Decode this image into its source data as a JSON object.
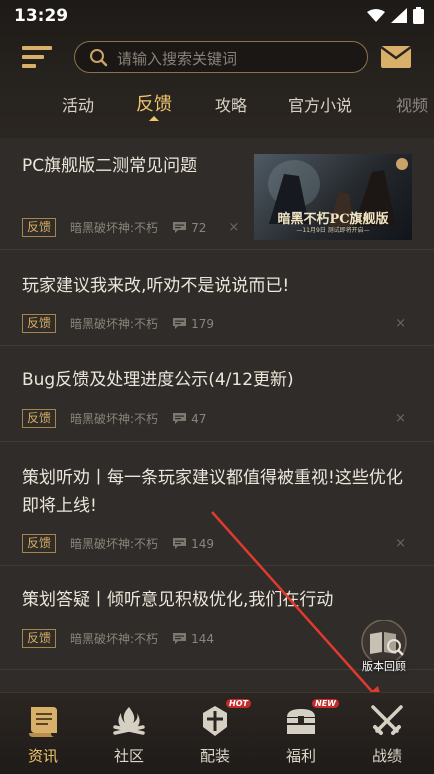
{
  "status": {
    "time": "13:29"
  },
  "search": {
    "placeholder": "请输入搜索关键词"
  },
  "tabs": [
    {
      "label": "活动"
    },
    {
      "label": "反馈"
    },
    {
      "label": "攻略"
    },
    {
      "label": "官方小说"
    },
    {
      "label": "视频"
    }
  ],
  "active_tab": "反馈",
  "articles": [
    {
      "title": "PC旗舰版二测常见问题",
      "tag": "反馈",
      "author": "暗黑破坏神:不朽",
      "comments": "72",
      "thumbnail": {
        "title": "暗黑不朽PC旗舰版",
        "subtitle": "—11月9日 测试即将开启—"
      }
    },
    {
      "title": "玩家建议我来改,听劝不是说说而已!",
      "tag": "反馈",
      "author": "暗黑破坏神:不朽",
      "comments": "179"
    },
    {
      "title": "Bug反馈及处理进度公示(4/12更新)",
      "tag": "反馈",
      "author": "暗黑破坏神:不朽",
      "comments": "47"
    },
    {
      "title_line1": "策划听劝丨每一条玩家建议都值得被重视!这些优化",
      "title_line2": "即将上线!",
      "tag": "反馈",
      "author": "暗黑破坏神:不朽",
      "comments": "149"
    },
    {
      "title": "策划答疑丨倾听意见积极优化,我们在行动",
      "tag": "反馈",
      "author": "暗黑破坏神:不朽",
      "comments": "144"
    }
  ],
  "close_symbol": "×",
  "floating": {
    "label": "版本回顾"
  },
  "bottom_nav": [
    {
      "label": "资讯",
      "icon": "scroll-icon"
    },
    {
      "label": "社区",
      "icon": "campfire-icon"
    },
    {
      "label": "配装",
      "icon": "helmet-icon",
      "badge": "HOT"
    },
    {
      "label": "福利",
      "icon": "chest-icon",
      "badge": "NEW"
    },
    {
      "label": "战绩",
      "icon": "crossed-swords-icon"
    }
  ],
  "colors": {
    "accent": "#f0c56b",
    "background": "#2f2c29",
    "tag_border": "#a78548",
    "annotation_arrow": "#e03a2f"
  }
}
